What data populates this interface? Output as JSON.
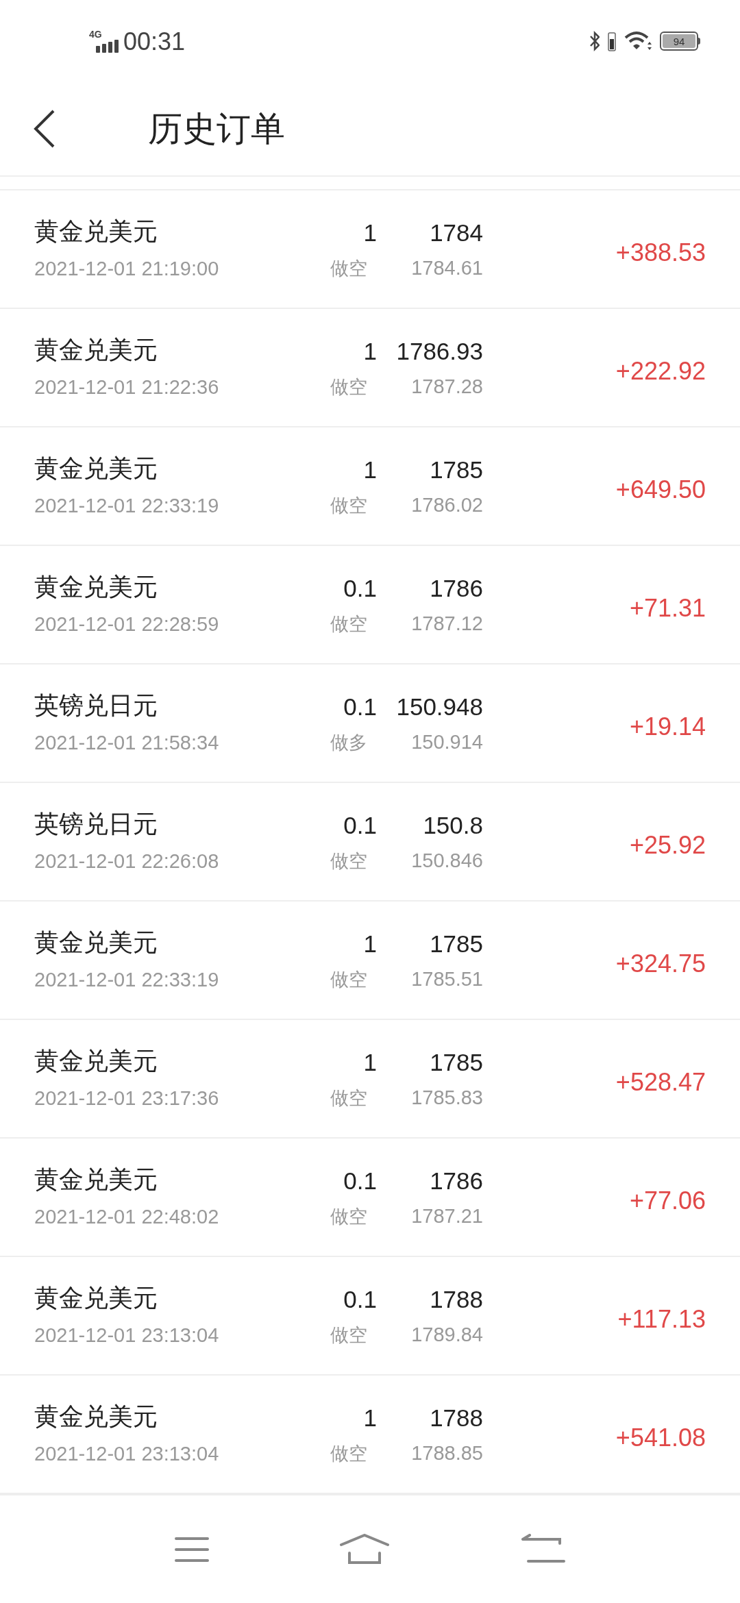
{
  "status_bar": {
    "network": "4G",
    "time": "00:31",
    "battery": "94"
  },
  "header": {
    "title": "历史订单"
  },
  "orders": [
    {
      "pair": "黄金兑美元",
      "time": "2021-12-01 21:19:00",
      "lots": "1",
      "open_price": "1784",
      "side": "做空",
      "close_price": "1784.61",
      "profit": "+388.53"
    },
    {
      "pair": "黄金兑美元",
      "time": "2021-12-01 21:22:36",
      "lots": "1",
      "open_price": "1786.93",
      "side": "做空",
      "close_price": "1787.28",
      "profit": "+222.92"
    },
    {
      "pair": "黄金兑美元",
      "time": "2021-12-01 22:33:19",
      "lots": "1",
      "open_price": "1785",
      "side": "做空",
      "close_price": "1786.02",
      "profit": "+649.50"
    },
    {
      "pair": "黄金兑美元",
      "time": "2021-12-01 22:28:59",
      "lots": "0.1",
      "open_price": "1786",
      "side": "做空",
      "close_price": "1787.12",
      "profit": "+71.31"
    },
    {
      "pair": "英镑兑日元",
      "time": "2021-12-01 21:58:34",
      "lots": "0.1",
      "open_price": "150.948",
      "side": "做多",
      "close_price": "150.914",
      "profit": "+19.14"
    },
    {
      "pair": "英镑兑日元",
      "time": "2021-12-01 22:26:08",
      "lots": "0.1",
      "open_price": "150.8",
      "side": "做空",
      "close_price": "150.846",
      "profit": "+25.92"
    },
    {
      "pair": "黄金兑美元",
      "time": "2021-12-01 22:33:19",
      "lots": "1",
      "open_price": "1785",
      "side": "做空",
      "close_price": "1785.51",
      "profit": "+324.75"
    },
    {
      "pair": "黄金兑美元",
      "time": "2021-12-01 23:17:36",
      "lots": "1",
      "open_price": "1785",
      "side": "做空",
      "close_price": "1785.83",
      "profit": "+528.47"
    },
    {
      "pair": "黄金兑美元",
      "time": "2021-12-01 22:48:02",
      "lots": "0.1",
      "open_price": "1786",
      "side": "做空",
      "close_price": "1787.21",
      "profit": "+77.06"
    },
    {
      "pair": "黄金兑美元",
      "time": "2021-12-01 23:13:04",
      "lots": "0.1",
      "open_price": "1788",
      "side": "做空",
      "close_price": "1789.84",
      "profit": "+117.13"
    },
    {
      "pair": "黄金兑美元",
      "time": "2021-12-01 23:13:04",
      "lots": "1",
      "open_price": "1788",
      "side": "做空",
      "close_price": "1788.85",
      "profit": "+541.08"
    }
  ]
}
